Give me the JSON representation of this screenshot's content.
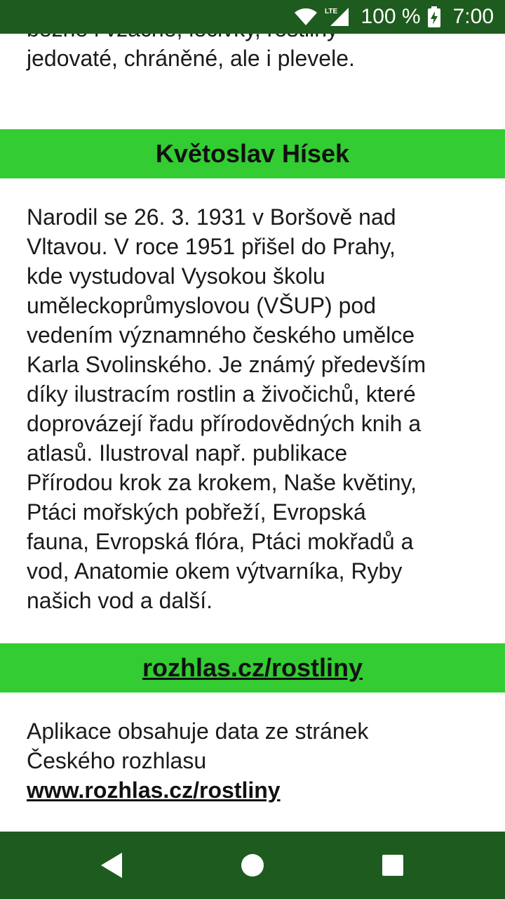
{
  "status_bar": {
    "network_label": "LTE",
    "battery_percent": "100 %",
    "time": "7:00",
    "icons": [
      "wifi-icon",
      "cell-signal-icon",
      "battery-charging-icon"
    ]
  },
  "article": {
    "intro_tail_lines": [
      "běžné i vzácné, léčivky, rostliny",
      "jedovaté, chráněné, ale i plevele."
    ],
    "author_heading": "Květoslav Hísek",
    "author_bio_lines": [
      "Narodil se 26. 3. 1931 v Boršově nad",
      "Vltavou. V roce 1951 přišel do Prahy,",
      "kde vystudoval Vysokou školu",
      "uměleckoprůmyslovou (VŠUP) pod",
      "vedením významného českého umělce",
      "Karla Svolinského. Je známý především",
      "díky ilustracím rostlin a živočichů, které",
      "doprovázejí řadu přírodovědných knih a",
      "atlasů. Ilustroval např. publikace",
      "Přírodou krok za krokem, Naše květiny,",
      "Ptáci mořských pobřeží, Evropská",
      "fauna, Evropská flóra, Ptáci mokřadů a",
      "vod, Anatomie okem výtvarníka, Ryby",
      "našich vod a další."
    ],
    "link_heading": "rozhlas.cz/rostliny",
    "source_note_line1": "Aplikace obsahuje data ze stránek",
    "source_note_line2": "Českého rozhlasu",
    "source_link": "www.rozhlas.cz/rostliny"
  },
  "navigation": {
    "buttons": [
      "back-icon",
      "home-icon",
      "recents-icon"
    ]
  },
  "colors": {
    "bar_background": "#1e5b1e",
    "section_header_background": "#33cc33",
    "text": "#1a1a1a"
  }
}
